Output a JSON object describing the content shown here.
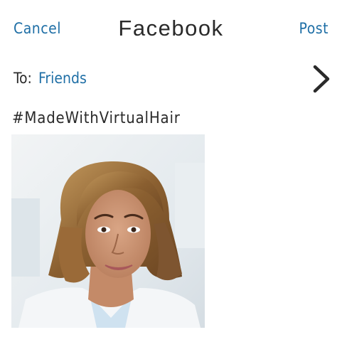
{
  "header": {
    "cancel_label": "Cancel",
    "title": "Facebook",
    "post_label": "Post"
  },
  "audience": {
    "label": "To:",
    "value": "Friends"
  },
  "post": {
    "caption": "#MadeWithVirtualHair"
  },
  "colors": {
    "link": "#1f6fa6",
    "text": "#2a2a2a"
  },
  "icons": {
    "chevron": "chevron-right-icon"
  }
}
